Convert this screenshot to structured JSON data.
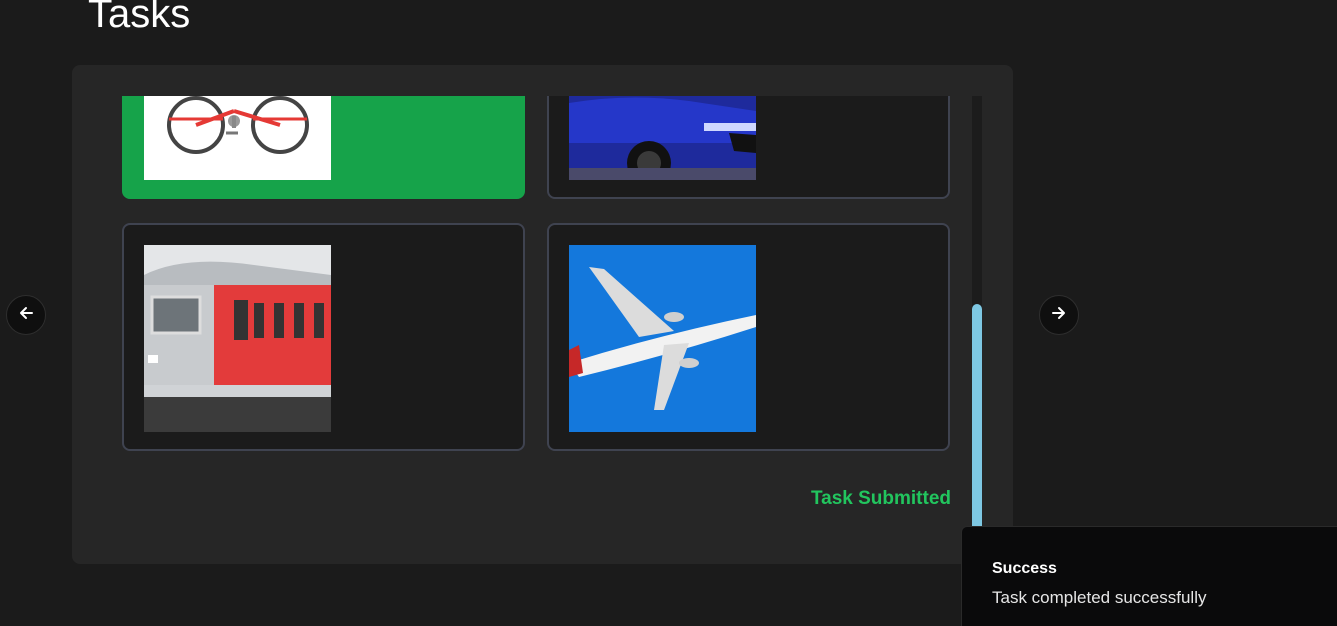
{
  "page": {
    "title": "Tasks"
  },
  "task": {
    "options": [
      {
        "subject": "bicycle",
        "selected": true
      },
      {
        "subject": "car",
        "selected": false
      },
      {
        "subject": "train",
        "selected": false
      },
      {
        "subject": "airplane",
        "selected": false
      }
    ],
    "status": "Task Submitted",
    "status_color": "#22c55e",
    "selected_color": "#16a34a"
  },
  "navigation": {
    "prev_icon": "arrow-left-icon",
    "next_icon": "arrow-right-icon"
  },
  "toast": {
    "title": "Success",
    "message": "Task completed successfully"
  }
}
